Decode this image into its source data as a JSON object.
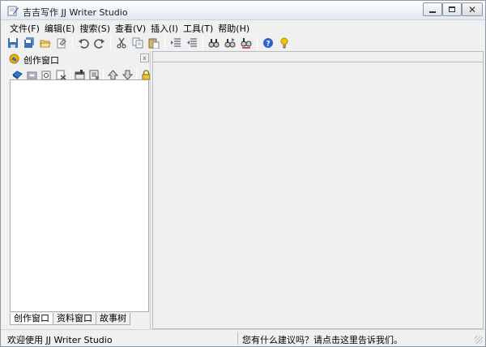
{
  "window": {
    "title": "吉吉写作 JJ Writer Studio",
    "controls": {
      "minimize_icon": "minimize-icon",
      "maximize_icon": "maximize-icon",
      "close_icon": "close-icon",
      "close_glyph": "✕"
    }
  },
  "menu": {
    "items": [
      {
        "label": "文件(F)"
      },
      {
        "label": "编辑(E)"
      },
      {
        "label": "搜索(S)"
      },
      {
        "label": "查看(V)"
      },
      {
        "label": "插入(I)"
      },
      {
        "label": "工具(T)"
      },
      {
        "label": "帮助(H)"
      }
    ]
  },
  "toolbar": {
    "groups": [
      [
        "save-icon",
        "save-all-icon",
        "open-icon",
        "paste-special-icon"
      ],
      [
        "undo-icon",
        "redo-icon"
      ],
      [
        "cut-icon",
        "copy-icon",
        "paste-icon"
      ],
      [
        "indent-icon",
        "outdent-icon"
      ],
      [
        "find-icon",
        "find-next-icon",
        "replace-icon"
      ],
      [
        "help-icon",
        "tip-icon"
      ]
    ]
  },
  "panel": {
    "title": "创作窗口",
    "close_glyph": "x",
    "tools": [
      [
        "new-book-icon",
        "new-folder-icon",
        "new-chapter-icon",
        "delete-icon"
      ],
      [
        "properties-icon",
        "notes-icon"
      ],
      [
        "move-up-icon",
        "move-down-icon"
      ],
      [
        "lock-icon"
      ]
    ],
    "tabs": [
      {
        "label": "创作窗口",
        "active": true
      },
      {
        "label": "资料窗口",
        "active": false
      },
      {
        "label": "故事树",
        "active": false
      }
    ]
  },
  "status": {
    "left": "欢迎使用 JJ Writer Studio",
    "right": "您有什么建议吗？请点击这里告诉我们。"
  },
  "colors": {
    "window_bg": "#f0f0f0",
    "border": "#8e99a6",
    "icon_blue": "#3c6fb4",
    "icon_yellow": "#e9b200"
  }
}
